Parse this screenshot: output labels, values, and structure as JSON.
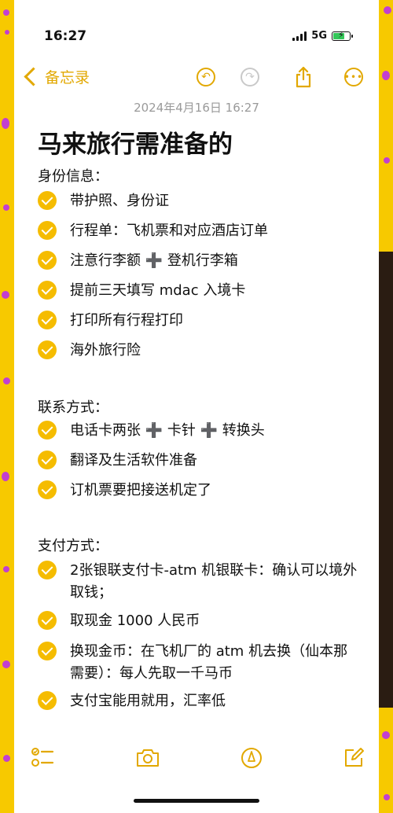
{
  "status_bar": {
    "time": "16:27",
    "network": "5G",
    "bolt": "⚡"
  },
  "nav": {
    "back_label": "备忘录",
    "undo_icon": "undo-icon",
    "redo_icon": "redo-icon",
    "share_icon": "share-icon",
    "more_icon": "more-icon"
  },
  "note": {
    "date": "2024年4月16日 16:27",
    "title": "马来旅行需准备的",
    "sections": [
      {
        "heading": "身份信息：",
        "items": [
          "带护照、身份证",
          "行程单：飞机票和对应酒店订单",
          "注意行李额 ➕ 登机行李箱",
          "提前三天填写 mdac 入境卡",
          "打印所有行程打印",
          "海外旅行险"
        ]
      },
      {
        "heading": "联系方式：",
        "items": [
          "电话卡两张 ➕ 卡针 ➕ 转换头",
          "翻译及生活软件准备",
          "订机票要把接送机定了"
        ]
      },
      {
        "heading": "支付方式：",
        "items": [
          "2张银联支付卡-atm 机银联卡：确认可以境外取钱；",
          "取现金 1000 人民币",
          "换现金币：在飞机厂的 atm 机去换（仙本那需要）：每人先取一千马币",
          "支付宝能用就用，汇率低"
        ]
      }
    ]
  },
  "toolbar": {
    "checklist_icon": "checklist-icon",
    "camera_icon": "camera-icon",
    "markup_icon": "markup-icon",
    "compose_icon": "compose-icon"
  },
  "colors": {
    "accent": "#e2a800",
    "check": "#f5bc00",
    "background": "#f7c900",
    "dots": "#c23fd0"
  }
}
